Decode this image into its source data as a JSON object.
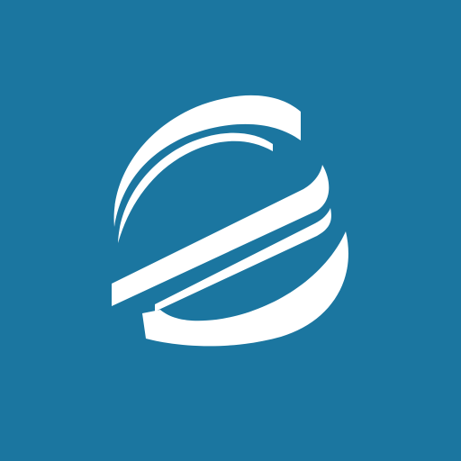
{
  "icon": {
    "name": "stylized-globe-logo",
    "background_color": "#1B76A0",
    "foreground_color": "#FFFFFF"
  }
}
